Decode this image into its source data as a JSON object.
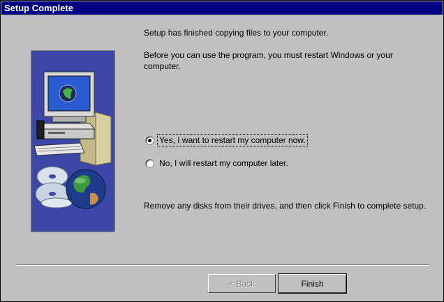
{
  "window": {
    "title": "Setup Complete"
  },
  "messages": {
    "copied": "Setup has finished copying files to your computer.",
    "restart_notice": "Before you can use the program, you must restart Windows or your computer.",
    "remove_disks": "Remove any disks from their drives, and then click Finish to complete setup."
  },
  "restart_options": {
    "selected": "yes",
    "yes_label": "Yes, I want to restart my computer now.",
    "no_label": "No, I will restart my computer later."
  },
  "buttons": {
    "back_label": "< Back",
    "finish_label": "Finish"
  },
  "colors": {
    "titlebar": "#000080",
    "dialog_bg": "#c0c0c0",
    "art_bg": "#3c47a8"
  },
  "illustration_icons": [
    "monitor-icon",
    "computer-case-icon",
    "keyboard-icon",
    "box-icon",
    "cd-icon",
    "globe-icon"
  ]
}
